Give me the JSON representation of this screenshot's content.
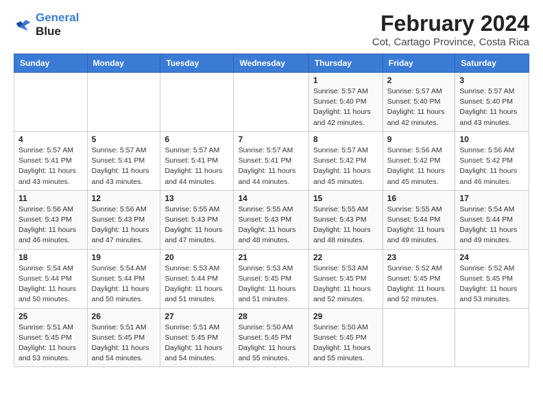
{
  "header": {
    "logo_line1": "General",
    "logo_line2": "Blue",
    "title": "February 2024",
    "subtitle": "Cot, Cartago Province, Costa Rica"
  },
  "weekdays": [
    "Sunday",
    "Monday",
    "Tuesday",
    "Wednesday",
    "Thursday",
    "Friday",
    "Saturday"
  ],
  "weeks": [
    [
      {
        "day": "",
        "info": ""
      },
      {
        "day": "",
        "info": ""
      },
      {
        "day": "",
        "info": ""
      },
      {
        "day": "",
        "info": ""
      },
      {
        "day": "1",
        "info": "Sunrise: 5:57 AM\nSunset: 5:40 PM\nDaylight: 11 hours and 42 minutes."
      },
      {
        "day": "2",
        "info": "Sunrise: 5:57 AM\nSunset: 5:40 PM\nDaylight: 11 hours and 42 minutes."
      },
      {
        "day": "3",
        "info": "Sunrise: 5:57 AM\nSunset: 5:40 PM\nDaylight: 11 hours and 43 minutes."
      }
    ],
    [
      {
        "day": "4",
        "info": "Sunrise: 5:57 AM\nSunset: 5:41 PM\nDaylight: 11 hours and 43 minutes."
      },
      {
        "day": "5",
        "info": "Sunrise: 5:57 AM\nSunset: 5:41 PM\nDaylight: 11 hours and 43 minutes."
      },
      {
        "day": "6",
        "info": "Sunrise: 5:57 AM\nSunset: 5:41 PM\nDaylight: 11 hours and 44 minutes."
      },
      {
        "day": "7",
        "info": "Sunrise: 5:57 AM\nSunset: 5:41 PM\nDaylight: 11 hours and 44 minutes."
      },
      {
        "day": "8",
        "info": "Sunrise: 5:57 AM\nSunset: 5:42 PM\nDaylight: 11 hours and 45 minutes."
      },
      {
        "day": "9",
        "info": "Sunrise: 5:56 AM\nSunset: 5:42 PM\nDaylight: 11 hours and 45 minutes."
      },
      {
        "day": "10",
        "info": "Sunrise: 5:56 AM\nSunset: 5:42 PM\nDaylight: 11 hours and 46 minutes."
      }
    ],
    [
      {
        "day": "11",
        "info": "Sunrise: 5:56 AM\nSunset: 5:43 PM\nDaylight: 11 hours and 46 minutes."
      },
      {
        "day": "12",
        "info": "Sunrise: 5:56 AM\nSunset: 5:43 PM\nDaylight: 11 hours and 47 minutes."
      },
      {
        "day": "13",
        "info": "Sunrise: 5:55 AM\nSunset: 5:43 PM\nDaylight: 11 hours and 47 minutes."
      },
      {
        "day": "14",
        "info": "Sunrise: 5:55 AM\nSunset: 5:43 PM\nDaylight: 11 hours and 48 minutes."
      },
      {
        "day": "15",
        "info": "Sunrise: 5:55 AM\nSunset: 5:43 PM\nDaylight: 11 hours and 48 minutes."
      },
      {
        "day": "16",
        "info": "Sunrise: 5:55 AM\nSunset: 5:44 PM\nDaylight: 11 hours and 49 minutes."
      },
      {
        "day": "17",
        "info": "Sunrise: 5:54 AM\nSunset: 5:44 PM\nDaylight: 11 hours and 49 minutes."
      }
    ],
    [
      {
        "day": "18",
        "info": "Sunrise: 5:54 AM\nSunset: 5:44 PM\nDaylight: 11 hours and 50 minutes."
      },
      {
        "day": "19",
        "info": "Sunrise: 5:54 AM\nSunset: 5:44 PM\nDaylight: 11 hours and 50 minutes."
      },
      {
        "day": "20",
        "info": "Sunrise: 5:53 AM\nSunset: 5:44 PM\nDaylight: 11 hours and 51 minutes."
      },
      {
        "day": "21",
        "info": "Sunrise: 5:53 AM\nSunset: 5:45 PM\nDaylight: 11 hours and 51 minutes."
      },
      {
        "day": "22",
        "info": "Sunrise: 5:53 AM\nSunset: 5:45 PM\nDaylight: 11 hours and 52 minutes."
      },
      {
        "day": "23",
        "info": "Sunrise: 5:52 AM\nSunset: 5:45 PM\nDaylight: 11 hours and 52 minutes."
      },
      {
        "day": "24",
        "info": "Sunrise: 5:52 AM\nSunset: 5:45 PM\nDaylight: 11 hours and 53 minutes."
      }
    ],
    [
      {
        "day": "25",
        "info": "Sunrise: 5:51 AM\nSunset: 5:45 PM\nDaylight: 11 hours and 53 minutes."
      },
      {
        "day": "26",
        "info": "Sunrise: 5:51 AM\nSunset: 5:45 PM\nDaylight: 11 hours and 54 minutes."
      },
      {
        "day": "27",
        "info": "Sunrise: 5:51 AM\nSunset: 5:45 PM\nDaylight: 11 hours and 54 minutes."
      },
      {
        "day": "28",
        "info": "Sunrise: 5:50 AM\nSunset: 5:45 PM\nDaylight: 11 hours and 55 minutes."
      },
      {
        "day": "29",
        "info": "Sunrise: 5:50 AM\nSunset: 5:45 PM\nDaylight: 11 hours and 55 minutes."
      },
      {
        "day": "",
        "info": ""
      },
      {
        "day": "",
        "info": ""
      }
    ]
  ]
}
